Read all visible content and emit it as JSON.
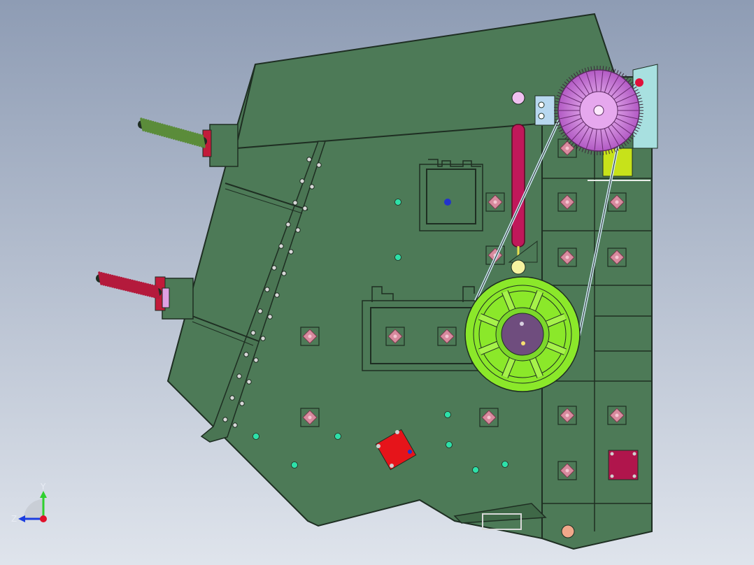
{
  "viewport": {
    "background_top": "#8e9cb4",
    "background_bottom": "#dfe4ec",
    "body_color": "#4d7a57",
    "edge_color": "#1e2e22",
    "bolt_color": "#d88a9e",
    "rivet_color": "#2ee0a8"
  },
  "triad": {
    "y_label": "Y",
    "z_label": "Z",
    "y_color": "#2fd02f",
    "z_color": "#1b3de0",
    "origin_color": "#e0102a"
  },
  "parts": {
    "motor_color": "#d987e6",
    "flywheel_color": "#8be82a",
    "hub_color": "#6f4d7e",
    "cylinder_color": "#c0185a",
    "spring_top_color": "#5b8c3a",
    "spring_bottom_color": "#b41a3c",
    "plate_red_color": "#e6141a",
    "plate_magenta_color": "#b0154c",
    "bracket_yellow_color": "#c7e21a"
  }
}
